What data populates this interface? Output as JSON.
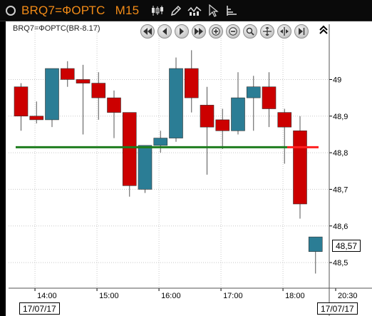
{
  "toolbar": {
    "symbol": "BRQ7=ФОРТС",
    "timeframe": "M15",
    "icons": [
      "candlestick-icon",
      "pencil-icon",
      "indicator-icon",
      "cursor-icon",
      "bar-style-icon"
    ]
  },
  "navigation": {
    "buttons": [
      "scroll-start",
      "scroll-left",
      "scroll-right",
      "scroll-end",
      "zoom-in",
      "zoom-out",
      "zoom-fit",
      "auto-scale",
      "split-view",
      "end-marker"
    ]
  },
  "chart_data": {
    "type": "candlestick",
    "title": "BRQ7=ФОРТС(BR-8.17)",
    "ylim": [
      48.43,
      49.11
    ],
    "yticks": [
      "49",
      "48,9",
      "48,8",
      "48,7",
      "48,6",
      "48,5"
    ],
    "ytick_values": [
      49.0,
      48.9,
      48.8,
      48.7,
      48.6,
      48.5
    ],
    "xticks": [
      "14:00",
      "15:00",
      "16:00",
      "17:00",
      "18:00",
      "20:30"
    ],
    "x_tick_slots": [
      0.9,
      4.9,
      8.9,
      12.9,
      16.9,
      20.3
    ],
    "date_labels": [
      "17/07/17",
      "17/07/17"
    ],
    "current_price": "48,57",
    "level_line": 48.815,
    "up_color": "#2b7d95",
    "down_color": "#cc0000",
    "level_color": "#1e7d1e",
    "level_end_color": "#ff2020",
    "candles": [
      {
        "o": 48.98,
        "h": 48.99,
        "l": 48.86,
        "c": 48.9
      },
      {
        "o": 48.9,
        "h": 48.94,
        "l": 48.88,
        "c": 48.89
      },
      {
        "o": 48.89,
        "h": 48.96,
        "l": 48.87,
        "c": 49.03
      },
      {
        "o": 49.03,
        "h": 49.05,
        "l": 48.98,
        "c": 49.0
      },
      {
        "o": 49.0,
        "h": 49.04,
        "l": 48.85,
        "c": 48.99
      },
      {
        "o": 48.99,
        "h": 49.02,
        "l": 48.89,
        "c": 48.95
      },
      {
        "o": 48.95,
        "h": 48.97,
        "l": 48.84,
        "c": 48.91
      },
      {
        "o": 48.91,
        "h": 48.91,
        "l": 48.68,
        "c": 48.71
      },
      {
        "o": 48.7,
        "h": 48.82,
        "l": 48.69,
        "c": 48.82
      },
      {
        "o": 48.82,
        "h": 48.86,
        "l": 48.8,
        "c": 48.84
      },
      {
        "o": 48.84,
        "h": 49.06,
        "l": 48.83,
        "c": 49.03
      },
      {
        "o": 49.03,
        "h": 49.08,
        "l": 48.91,
        "c": 48.95
      },
      {
        "o": 48.93,
        "h": 48.98,
        "l": 48.74,
        "c": 48.87
      },
      {
        "o": 48.89,
        "h": 48.92,
        "l": 48.81,
        "c": 48.86
      },
      {
        "o": 48.86,
        "h": 49.02,
        "l": 48.85,
        "c": 48.95
      },
      {
        "o": 48.95,
        "h": 49.01,
        "l": 48.86,
        "c": 48.98
      },
      {
        "o": 48.98,
        "h": 49.02,
        "l": 48.87,
        "c": 48.92
      },
      {
        "o": 48.91,
        "h": 48.92,
        "l": 48.77,
        "c": 48.87
      },
      {
        "o": 48.86,
        "h": 48.9,
        "l": 48.62,
        "c": 48.66
      },
      {
        "o": 48.53,
        "h": 48.57,
        "l": 48.47,
        "c": 48.57
      }
    ]
  }
}
